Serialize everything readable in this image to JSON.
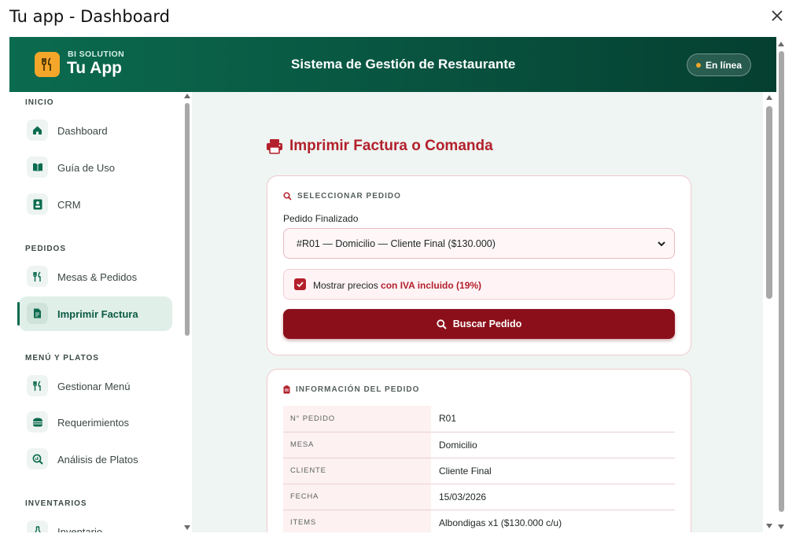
{
  "window": {
    "title": "Tu app - Dashboard"
  },
  "header": {
    "brand_small": "BI SOLUTION",
    "brand_big": "Tu App",
    "system_title": "Sistema de Gestión de Restaurante",
    "status_label": "En línea"
  },
  "sidebar": {
    "sections": [
      {
        "title": "INICIO",
        "items": [
          {
            "label": "Dashboard",
            "icon": "home-icon"
          },
          {
            "label": "Guía de Uso",
            "icon": "book-icon"
          },
          {
            "label": "CRM",
            "icon": "contact-card-icon"
          }
        ]
      },
      {
        "title": "PEDIDOS",
        "items": [
          {
            "label": "Mesas & Pedidos",
            "icon": "utensils-icon"
          },
          {
            "label": "Imprimir Factura",
            "icon": "receipt-icon",
            "active": true
          }
        ]
      },
      {
        "title": "MENÚ Y PLATOS",
        "items": [
          {
            "label": "Gestionar Menú",
            "icon": "utensils-icon"
          },
          {
            "label": "Requerimientos",
            "icon": "burger-icon"
          },
          {
            "label": "Análisis de Platos",
            "icon": "search-chart-icon"
          }
        ]
      },
      {
        "title": "INVENTARIOS",
        "items": [
          {
            "label": "Inventario",
            "icon": "flask-icon"
          }
        ]
      }
    ]
  },
  "main": {
    "page_title": "Imprimir Factura o Comanda",
    "select_card": {
      "heading": "SELECCIONAR PEDIDO",
      "field_label": "Pedido Finalizado",
      "selected_value": "#R01 — Domicilio — Cliente Final ($130.000)",
      "checkbox_text": "Mostrar precios ",
      "checkbox_highlight": "con IVA incluido (19%)",
      "checkbox_checked": true,
      "button_label": "Buscar Pedido"
    },
    "info_card": {
      "heading": "INFORMACIÓN DEL PEDIDO",
      "rows": [
        {
          "key": "N° PEDIDO",
          "value": "R01"
        },
        {
          "key": "MESA",
          "value": "Domicilio"
        },
        {
          "key": "CLIENTE",
          "value": "Cliente Final"
        },
        {
          "key": "FECHA",
          "value": "15/03/2026"
        },
        {
          "key": "ITEMS",
          "value": "Albondigas x1 ($130.000 c/u)"
        }
      ]
    }
  },
  "colors": {
    "brand_green": "#0b6b4e",
    "accent_red": "#b3202c",
    "button_red": "#8b0f1a",
    "logo_orange": "#f4a62a"
  }
}
